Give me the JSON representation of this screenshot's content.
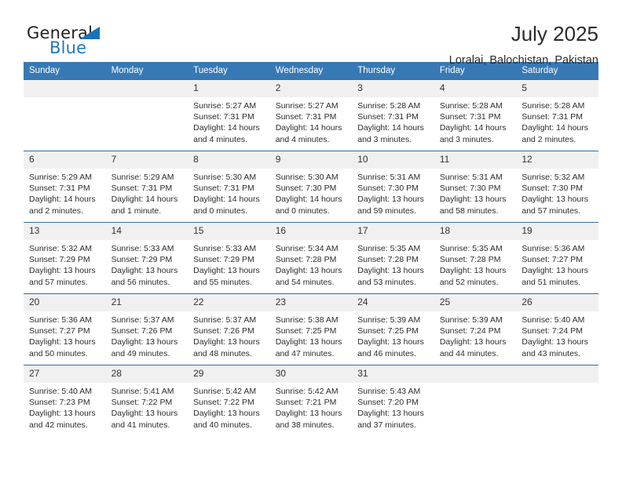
{
  "brand": {
    "word_one": "General",
    "word_two": "Blue",
    "triangle_icon": "triangle-icon"
  },
  "header": {
    "title": "July 2025",
    "location": "Loralai, Balochistan, Pakistan"
  },
  "colors": {
    "header_blue": "#3679b5",
    "row_border_blue": "#2f6ea5",
    "daynum_gray": "#f0f0f0",
    "logo_blue": "#2077bc"
  },
  "weekday_headers": [
    "Sunday",
    "Monday",
    "Tuesday",
    "Wednesday",
    "Thursday",
    "Friday",
    "Saturday"
  ],
  "labels": {
    "sunrise_prefix": "Sunrise: ",
    "sunset_prefix": "Sunset: ",
    "daylight_prefix": "Daylight: "
  },
  "weeks": [
    [
      {
        "day": "",
        "empty": true
      },
      {
        "day": "",
        "empty": true
      },
      {
        "day": "1",
        "sunrise": "Sunrise: 5:27 AM",
        "sunset": "Sunset: 7:31 PM",
        "daylight": "Daylight: 14 hours and 4 minutes."
      },
      {
        "day": "2",
        "sunrise": "Sunrise: 5:27 AM",
        "sunset": "Sunset: 7:31 PM",
        "daylight": "Daylight: 14 hours and 4 minutes."
      },
      {
        "day": "3",
        "sunrise": "Sunrise: 5:28 AM",
        "sunset": "Sunset: 7:31 PM",
        "daylight": "Daylight: 14 hours and 3 minutes."
      },
      {
        "day": "4",
        "sunrise": "Sunrise: 5:28 AM",
        "sunset": "Sunset: 7:31 PM",
        "daylight": "Daylight: 14 hours and 3 minutes."
      },
      {
        "day": "5",
        "sunrise": "Sunrise: 5:28 AM",
        "sunset": "Sunset: 7:31 PM",
        "daylight": "Daylight: 14 hours and 2 minutes."
      }
    ],
    [
      {
        "day": "6",
        "sunrise": "Sunrise: 5:29 AM",
        "sunset": "Sunset: 7:31 PM",
        "daylight": "Daylight: 14 hours and 2 minutes."
      },
      {
        "day": "7",
        "sunrise": "Sunrise: 5:29 AM",
        "sunset": "Sunset: 7:31 PM",
        "daylight": "Daylight: 14 hours and 1 minute."
      },
      {
        "day": "8",
        "sunrise": "Sunrise: 5:30 AM",
        "sunset": "Sunset: 7:31 PM",
        "daylight": "Daylight: 14 hours and 0 minutes."
      },
      {
        "day": "9",
        "sunrise": "Sunrise: 5:30 AM",
        "sunset": "Sunset: 7:30 PM",
        "daylight": "Daylight: 14 hours and 0 minutes."
      },
      {
        "day": "10",
        "sunrise": "Sunrise: 5:31 AM",
        "sunset": "Sunset: 7:30 PM",
        "daylight": "Daylight: 13 hours and 59 minutes."
      },
      {
        "day": "11",
        "sunrise": "Sunrise: 5:31 AM",
        "sunset": "Sunset: 7:30 PM",
        "daylight": "Daylight: 13 hours and 58 minutes."
      },
      {
        "day": "12",
        "sunrise": "Sunrise: 5:32 AM",
        "sunset": "Sunset: 7:30 PM",
        "daylight": "Daylight: 13 hours and 57 minutes."
      }
    ],
    [
      {
        "day": "13",
        "sunrise": "Sunrise: 5:32 AM",
        "sunset": "Sunset: 7:29 PM",
        "daylight": "Daylight: 13 hours and 57 minutes."
      },
      {
        "day": "14",
        "sunrise": "Sunrise: 5:33 AM",
        "sunset": "Sunset: 7:29 PM",
        "daylight": "Daylight: 13 hours and 56 minutes."
      },
      {
        "day": "15",
        "sunrise": "Sunrise: 5:33 AM",
        "sunset": "Sunset: 7:29 PM",
        "daylight": "Daylight: 13 hours and 55 minutes."
      },
      {
        "day": "16",
        "sunrise": "Sunrise: 5:34 AM",
        "sunset": "Sunset: 7:28 PM",
        "daylight": "Daylight: 13 hours and 54 minutes."
      },
      {
        "day": "17",
        "sunrise": "Sunrise: 5:35 AM",
        "sunset": "Sunset: 7:28 PM",
        "daylight": "Daylight: 13 hours and 53 minutes."
      },
      {
        "day": "18",
        "sunrise": "Sunrise: 5:35 AM",
        "sunset": "Sunset: 7:28 PM",
        "daylight": "Daylight: 13 hours and 52 minutes."
      },
      {
        "day": "19",
        "sunrise": "Sunrise: 5:36 AM",
        "sunset": "Sunset: 7:27 PM",
        "daylight": "Daylight: 13 hours and 51 minutes."
      }
    ],
    [
      {
        "day": "20",
        "sunrise": "Sunrise: 5:36 AM",
        "sunset": "Sunset: 7:27 PM",
        "daylight": "Daylight: 13 hours and 50 minutes."
      },
      {
        "day": "21",
        "sunrise": "Sunrise: 5:37 AM",
        "sunset": "Sunset: 7:26 PM",
        "daylight": "Daylight: 13 hours and 49 minutes."
      },
      {
        "day": "22",
        "sunrise": "Sunrise: 5:37 AM",
        "sunset": "Sunset: 7:26 PM",
        "daylight": "Daylight: 13 hours and 48 minutes."
      },
      {
        "day": "23",
        "sunrise": "Sunrise: 5:38 AM",
        "sunset": "Sunset: 7:25 PM",
        "daylight": "Daylight: 13 hours and 47 minutes."
      },
      {
        "day": "24",
        "sunrise": "Sunrise: 5:39 AM",
        "sunset": "Sunset: 7:25 PM",
        "daylight": "Daylight: 13 hours and 46 minutes."
      },
      {
        "day": "25",
        "sunrise": "Sunrise: 5:39 AM",
        "sunset": "Sunset: 7:24 PM",
        "daylight": "Daylight: 13 hours and 44 minutes."
      },
      {
        "day": "26",
        "sunrise": "Sunrise: 5:40 AM",
        "sunset": "Sunset: 7:24 PM",
        "daylight": "Daylight: 13 hours and 43 minutes."
      }
    ],
    [
      {
        "day": "27",
        "sunrise": "Sunrise: 5:40 AM",
        "sunset": "Sunset: 7:23 PM",
        "daylight": "Daylight: 13 hours and 42 minutes."
      },
      {
        "day": "28",
        "sunrise": "Sunrise: 5:41 AM",
        "sunset": "Sunset: 7:22 PM",
        "daylight": "Daylight: 13 hours and 41 minutes."
      },
      {
        "day": "29",
        "sunrise": "Sunrise: 5:42 AM",
        "sunset": "Sunset: 7:22 PM",
        "daylight": "Daylight: 13 hours and 40 minutes."
      },
      {
        "day": "30",
        "sunrise": "Sunrise: 5:42 AM",
        "sunset": "Sunset: 7:21 PM",
        "daylight": "Daylight: 13 hours and 38 minutes."
      },
      {
        "day": "31",
        "sunrise": "Sunrise: 5:43 AM",
        "sunset": "Sunset: 7:20 PM",
        "daylight": "Daylight: 13 hours and 37 minutes."
      },
      {
        "day": "",
        "empty": true
      },
      {
        "day": "",
        "empty": true
      }
    ]
  ]
}
